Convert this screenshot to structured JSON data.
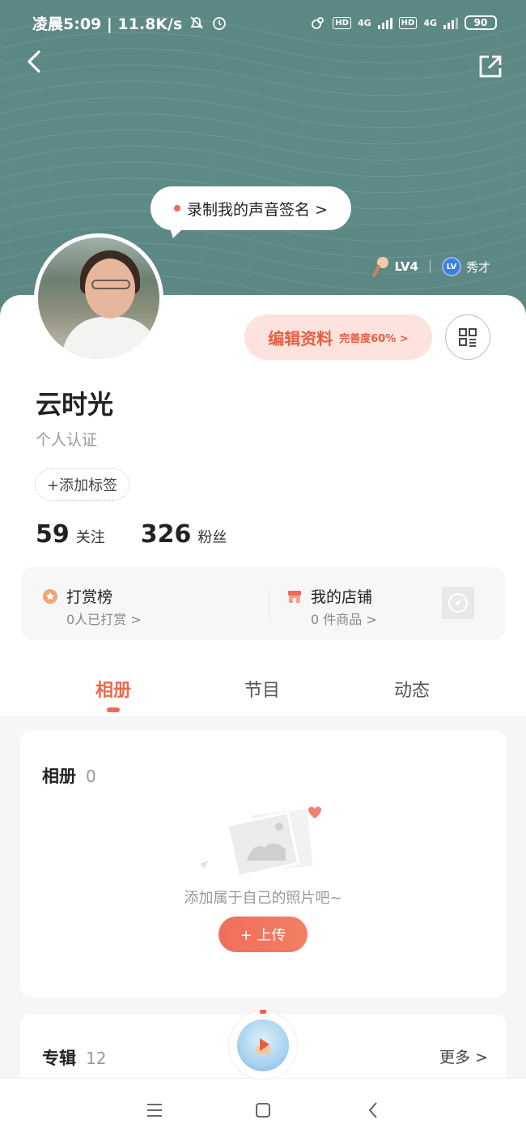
{
  "status_bar": {
    "time_speed": "凌晨5:09 | 11.8K/s",
    "hd1": "HD",
    "net1": "4G",
    "hd2": "HD",
    "net2": "4G",
    "battery": "90"
  },
  "header": {
    "voice_signature": "录制我的声音签名 >",
    "level": "LV4",
    "lv_badge": "LV",
    "title_rank": "秀才"
  },
  "profile": {
    "edit_label": "编辑资料",
    "completeness": "完善度60% >",
    "name": "云时光",
    "verify": "个人认证",
    "add_tag": "+添加标签",
    "following_count": "59",
    "following_label": "关注",
    "fans_count": "326",
    "fans_label": "粉丝"
  },
  "info": {
    "reward_title": "打赏榜",
    "reward_sub": "0人已打赏 >",
    "shop_title": "我的店铺",
    "shop_sub": "0 件商品 >"
  },
  "tabs": [
    {
      "label": "相册"
    },
    {
      "label": "节目"
    },
    {
      "label": "动态"
    }
  ],
  "album": {
    "title": "相册",
    "count": "0",
    "empty_text": "添加属于自己的照片吧~",
    "upload_label": "+ 上传"
  },
  "zhuanji": {
    "title": "专辑",
    "count": "12",
    "more": "更多 >"
  },
  "colors": {
    "accent": "#ea6a4f",
    "header_bg": "#5e8b88"
  }
}
